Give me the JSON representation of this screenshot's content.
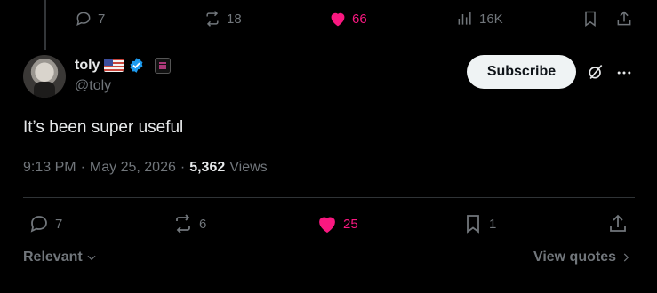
{
  "parent_actions": {
    "replies": "7",
    "reposts": "18",
    "likes": "66",
    "views": "16K"
  },
  "author": {
    "display_name": "toly",
    "handle": "@toly",
    "flag_icon": "us-flag-icon",
    "verified_color": "#1d9bf0"
  },
  "header": {
    "subscribe_label": "Subscribe"
  },
  "tweet": {
    "text": "It’s been super useful",
    "time": "9:13 PM",
    "separator1": "·",
    "date": "May 25, 2026",
    "separator2": "·",
    "views_count": "5,362",
    "views_label": "Views"
  },
  "actions": {
    "replies": "7",
    "reposts": "6",
    "likes": "25",
    "bookmarks": "1"
  },
  "footer": {
    "sort_label": "Relevant",
    "quotes_label": "View quotes"
  },
  "colors": {
    "background": "#000000",
    "like": "#f91880",
    "muted": "#71767b",
    "text": "#e7e9ea"
  }
}
